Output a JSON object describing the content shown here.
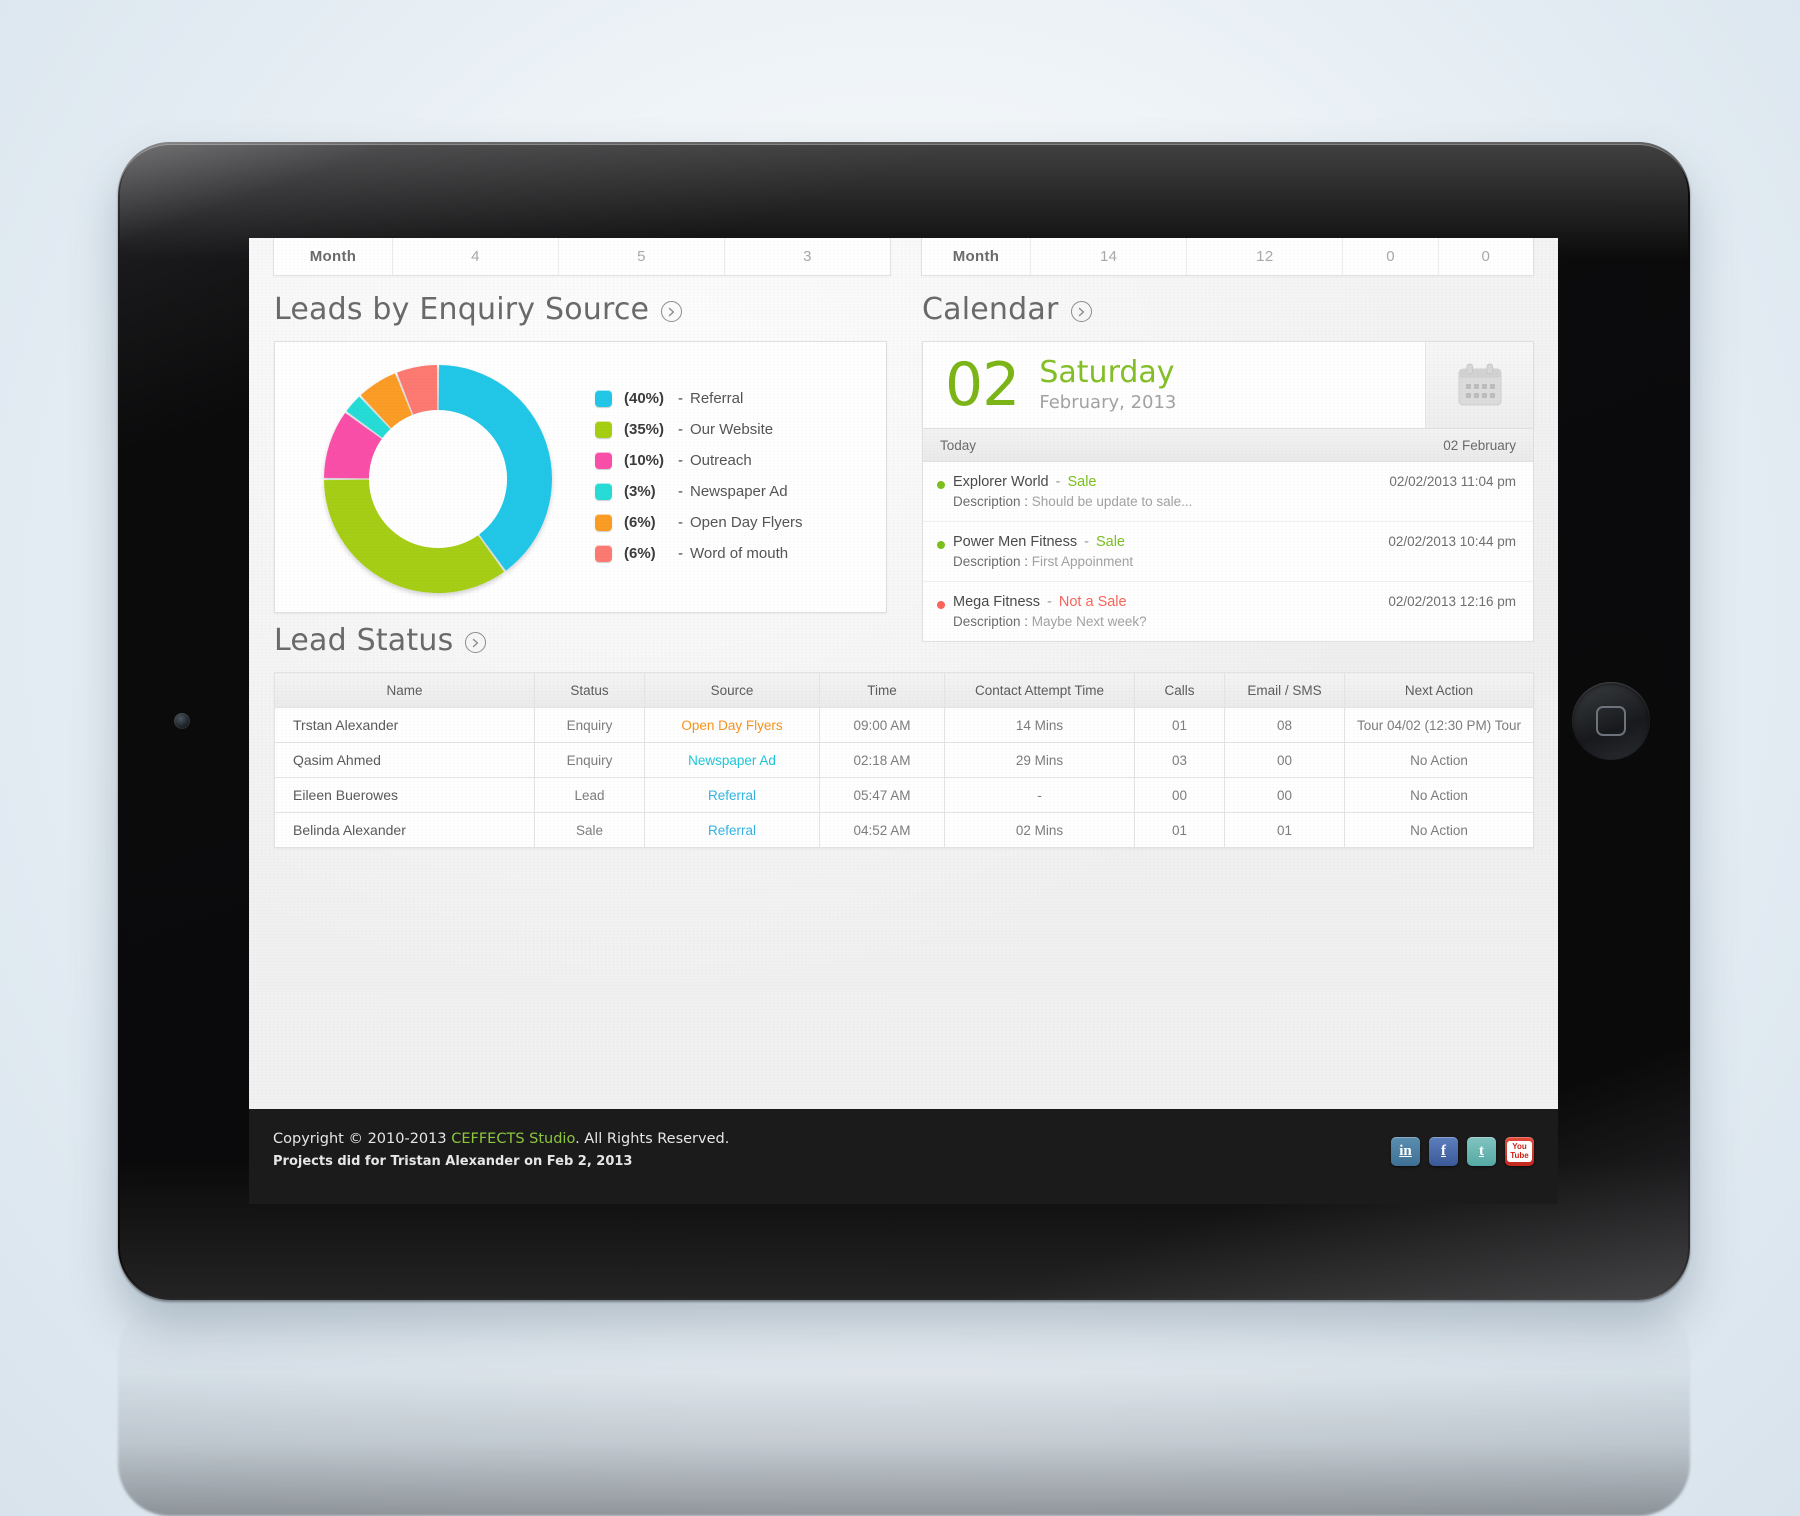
{
  "stat_strips": {
    "left": {
      "label": "Month",
      "values": [
        "4",
        "5",
        "3"
      ]
    },
    "right": {
      "label": "Month",
      "values": [
        "14",
        "12",
        "0",
        "0"
      ]
    }
  },
  "sections": {
    "leads_by_enquiry_source": "Leads by Enquiry Source",
    "calendar": "Calendar",
    "lead_status": "Lead Status"
  },
  "chart_data": {
    "type": "pie",
    "title": "Leads by Enquiry Source",
    "subtype": "donut",
    "legend_position": "right",
    "categories": [
      "Referral",
      "Our Website",
      "Outreach",
      "Newspaper Ad",
      "Open Day Flyers",
      "Word of mouth"
    ],
    "values": [
      40,
      35,
      10,
      3,
      6,
      6
    ],
    "unit": "%",
    "colors": [
      "#22c7e8",
      "#a6ce12",
      "#fa4fa8",
      "#27dcd6",
      "#fb9d25",
      "#fc7a72"
    ],
    "legend": [
      {
        "pct": "(40%)",
        "dash": "-",
        "label": "Referral",
        "color": "#22c7e8"
      },
      {
        "pct": "(35%)",
        "dash": "-",
        "label": "Our Website",
        "color": "#a6ce12"
      },
      {
        "pct": "(10%)",
        "dash": "-",
        "label": "Outreach",
        "color": "#fa4fa8"
      },
      {
        "pct": "(3%)",
        "dash": "-",
        "label": "Newspaper Ad",
        "color": "#27dcd6"
      },
      {
        "pct": "(6%)",
        "dash": "-",
        "label": "Open Day Flyers",
        "color": "#fb9d25"
      },
      {
        "pct": "(6%)",
        "dash": "-",
        "label": "Word of mouth",
        "color": "#fc7a72"
      }
    ]
  },
  "calendar": {
    "day_number": "02",
    "weekday": "Saturday",
    "month_year": "February, 2013",
    "subhead_left": "Today",
    "subhead_right": "02  February",
    "icon": "calendar-icon",
    "events": [
      {
        "title": "Explorer World",
        "separator": "-",
        "status": "Sale",
        "status_color": "#7cc01e",
        "dot_color": "#7cc01e",
        "time": "02/02/2013 11:04 pm",
        "desc_label": "Description :",
        "desc_text": "Should be update to sale..."
      },
      {
        "title": "Power Men Fitness",
        "separator": "-",
        "status": "Sale",
        "status_color": "#7cc01e",
        "dot_color": "#7cc01e",
        "time": "02/02/2013 10:44 pm",
        "desc_label": "Description :",
        "desc_text": "First Appoinment"
      },
      {
        "title": "Mega Fitness",
        "separator": "-",
        "status": "Not a Sale",
        "status_color": "#f9655b",
        "dot_color": "#f9655b",
        "time": "02/02/2013 12:16 pm",
        "desc_label": "Description :",
        "desc_text": "Maybe Next week?"
      }
    ]
  },
  "lead_status_table": {
    "columns": [
      "Name",
      "Status",
      "Source",
      "Time",
      "Contact Attempt Time",
      "Calls",
      "Email / SMS",
      "Next Action"
    ],
    "rows": [
      {
        "name": "Trstan Alexander",
        "status": "Enquiry",
        "source": "Open Day Flyers",
        "source_color": "#f7941e",
        "time": "09:00 AM",
        "attempt": "14 Mins",
        "calls": "01",
        "email_sms": "08",
        "next_action": "Tour 04/02 (12:30 PM) Tour"
      },
      {
        "name": "Qasim Ahmed",
        "status": "Enquiry",
        "source": "Newspaper Ad",
        "source_color": "#1fc5d8",
        "time": "02:18 AM",
        "attempt": "29 Mins",
        "calls": "03",
        "email_sms": "00",
        "next_action": "No Action"
      },
      {
        "name": "Eileen Buerowes",
        "status": "Lead",
        "source": "Referral",
        "source_color": "#34b3e0",
        "time": "05:47 AM",
        "attempt": "-",
        "calls": "00",
        "email_sms": "00",
        "next_action": "No Action"
      },
      {
        "name": "Belinda Alexander",
        "status": "Sale",
        "source": "Referral",
        "source_color": "#34b3e0",
        "time": "04:52 AM",
        "attempt": "02 Mins",
        "calls": "01",
        "email_sms": "01",
        "next_action": "No Action"
      }
    ]
  },
  "footer": {
    "copyright_prefix": "Copyright © 2010-2013 ",
    "brand": "CEFFECTS Studio",
    "copyright_suffix": ". All Rights Reserved.",
    "projects_line": "Projects did for Tristan Alexander on Feb 2, 2013",
    "brand_color": "#8cc63f",
    "social": [
      {
        "name": "linkedin-icon",
        "glyph": "in",
        "class": "si-linkedin"
      },
      {
        "name": "facebook-icon",
        "glyph": "f",
        "class": "si-facebook"
      },
      {
        "name": "twitter-icon",
        "glyph": "t",
        "class": "si-twitter"
      },
      {
        "name": "youtube-icon",
        "glyph": "You Tube",
        "class": "si-youtube"
      }
    ]
  }
}
